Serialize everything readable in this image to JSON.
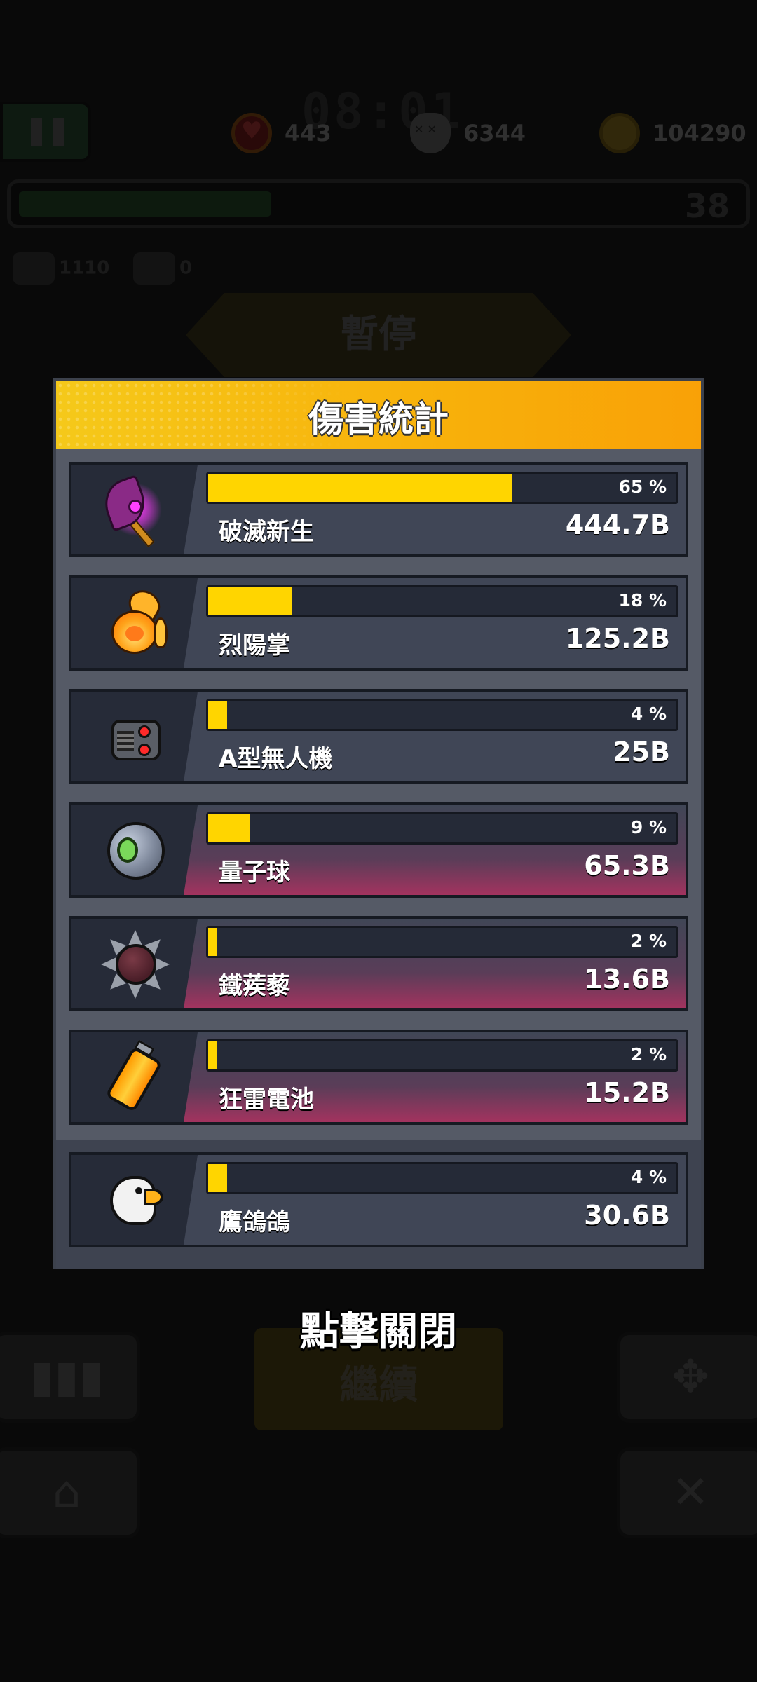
{
  "hud": {
    "timer": "08:01",
    "hearts": "443",
    "kills": "6344",
    "coins": "104290",
    "level": "38",
    "mini_stat_1": "1110",
    "mini_stat_2": "0"
  },
  "pause_title": "暫停",
  "continue_label": "繼續",
  "close_hint": "點擊關閉",
  "panel": {
    "title": "傷害統計",
    "items": [
      {
        "name": "破滅新生",
        "damage": "444.7B",
        "percent_label": "65 %",
        "percent": 65,
        "icon": "axe-icon"
      },
      {
        "name": "烈陽掌",
        "damage": "125.2B",
        "percent_label": "18 %",
        "percent": 18,
        "icon": "fire-paw-icon"
      },
      {
        "name": "A型無人機",
        "damage": "25B",
        "percent_label": "4 %",
        "percent": 4,
        "icon": "drone-icon"
      },
      {
        "name": "量子球",
        "damage": "65.3B",
        "percent_label": "9 %",
        "percent": 9,
        "icon": "quantum-orb-icon"
      },
      {
        "name": "鐵蒺藜",
        "damage": "13.6B",
        "percent_label": "2 %",
        "percent": 2,
        "icon": "spiked-ball-icon"
      },
      {
        "name": "狂雷電池",
        "damage": "15.2B",
        "percent_label": "2 %",
        "percent": 2,
        "icon": "battery-icon"
      }
    ],
    "companion": {
      "name": "鷹鴿鴿",
      "damage": "30.6B",
      "percent_label": "4 %",
      "percent": 4,
      "icon": "eagle-icon"
    }
  },
  "colors": {
    "bar_fill": "#ffd500",
    "header_yellow": "#f8b20b",
    "row_dark": "#262b38",
    "panel_bg": "#555a66",
    "pink_accent": "#a3335f"
  }
}
